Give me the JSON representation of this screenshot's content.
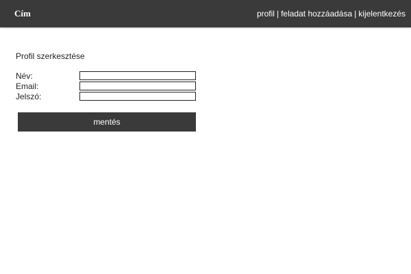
{
  "header": {
    "brand": "Cím",
    "nav": [
      {
        "label": "profil"
      },
      {
        "label": "feladat hozzáadása"
      },
      {
        "label": "kijelentkezés"
      }
    ],
    "separator": "|"
  },
  "main": {
    "title": "Profil szerkesztése",
    "fields": {
      "name": {
        "label": "Név:",
        "value": ""
      },
      "email": {
        "label": "Email:",
        "value": ""
      },
      "password": {
        "label": "Jelszó:",
        "value": ""
      }
    },
    "save_label": "mentés"
  },
  "colors": {
    "header_bg": "#3a3a3a",
    "button_bg": "#3a3a3a",
    "text": "#222222"
  }
}
